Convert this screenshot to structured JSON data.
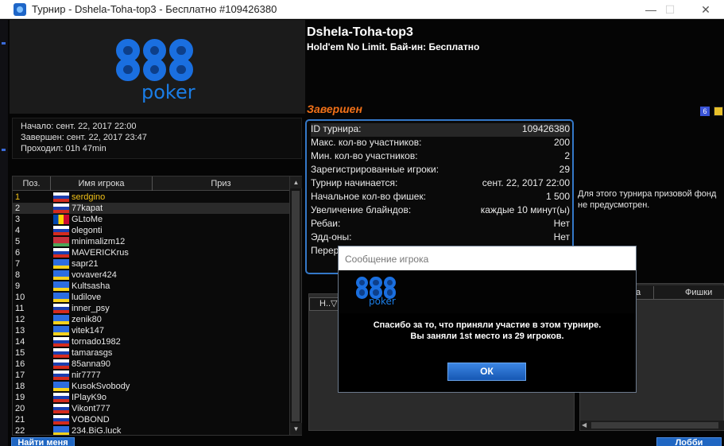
{
  "window": {
    "title": "Турнир - Dshela-Toha-top3 - Бесплатно #109426380",
    "app_icon": "poker-app-icon",
    "controls": {
      "minimize": "—",
      "maximize": "☐",
      "close": "✕"
    }
  },
  "logo": {
    "digits": "888",
    "word": "poker",
    "colors": {
      "ring": "#1a6fe0",
      "ring_inner": "#0d3f8a"
    }
  },
  "start_info": {
    "start": "Начало: сент. 22, 2017 22:00",
    "end": "Завершен: сент. 22, 2017 23:47",
    "elapsed": "Проходил: 01h 47min"
  },
  "players_table": {
    "headers": {
      "pos": "Поз.",
      "name": "Имя игрока",
      "prize": "Приз"
    },
    "rows": [
      {
        "pos": "1",
        "name": "serdgino",
        "flag": "ru"
      },
      {
        "pos": "2",
        "name": "77kapat",
        "flag": "ru"
      },
      {
        "pos": "3",
        "name": "GLtoMe",
        "flag": "md"
      },
      {
        "pos": "4",
        "name": "olegonti",
        "flag": "ru"
      },
      {
        "pos": "5",
        "name": "minimalizm12",
        "flag": "by"
      },
      {
        "pos": "6",
        "name": "MAVERICKrus",
        "flag": "ru"
      },
      {
        "pos": "7",
        "name": "sapr21",
        "flag": "ua"
      },
      {
        "pos": "8",
        "name": "vovaver424",
        "flag": "ua"
      },
      {
        "pos": "9",
        "name": "Kultsasha",
        "flag": "ua"
      },
      {
        "pos": "10",
        "name": "ludilove",
        "flag": "ua"
      },
      {
        "pos": "11",
        "name": "inner_psy",
        "flag": "ru"
      },
      {
        "pos": "12",
        "name": "zenik80",
        "flag": "ua"
      },
      {
        "pos": "13",
        "name": "vitek147",
        "flag": "ua"
      },
      {
        "pos": "14",
        "name": "tornado1982",
        "flag": "ru"
      },
      {
        "pos": "15",
        "name": "tamarasgs",
        "flag": "ru"
      },
      {
        "pos": "16",
        "name": "85anna90",
        "flag": "ru"
      },
      {
        "pos": "17",
        "name": "nir7777",
        "flag": "ru"
      },
      {
        "pos": "18",
        "name": "KusokSvobody",
        "flag": "ua"
      },
      {
        "pos": "19",
        "name": "IPlayK9o",
        "flag": "ru"
      },
      {
        "pos": "20",
        "name": "Vikont777",
        "flag": "ru"
      },
      {
        "pos": "21",
        "name": "VOBOND",
        "flag": "ru"
      },
      {
        "pos": "22",
        "name": "234.BiG.luck",
        "flag": "ua"
      }
    ],
    "selected_row": 1,
    "first_place_color": "#f0c018"
  },
  "buttons": {
    "find_me": "Найти меня",
    "lobby": "Лобби"
  },
  "tournament": {
    "name": "Dshela-Toha-top3",
    "type": "Hold'em No Limit. Бай-ин: Бесплатно",
    "status": "Завершен",
    "status_color": "#f07018"
  },
  "info": [
    {
      "k": "ID турнира:",
      "v": "109426380"
    },
    {
      "k": "Макс. кол-во участников:",
      "v": "200"
    },
    {
      "k": "Мин. кол-во участников:",
      "v": "2"
    },
    {
      "k": "Зарегистрированные игроки:",
      "v": "29"
    },
    {
      "k": "Турнир начинается:",
      "v": "сент. 22, 2017 22:00"
    },
    {
      "k": "Начальное кол-во фишек:",
      "v": "1 500"
    },
    {
      "k": "Увеличение блайндов:",
      "v": "каждые 10 минут(ы)"
    },
    {
      "k": "Ребаи:",
      "v": "Нет"
    },
    {
      "k": "Эдд-оны:",
      "v": "Нет"
    },
    {
      "k": "Перер",
      "v": ""
    }
  ],
  "prize_note": "Для этого турнира призовой фонд не предусмотрен.",
  "lower_left": {
    "header": "Н..▽"
  },
  "lower_right": {
    "col1": "а",
    "col2": "Фишки"
  },
  "modal": {
    "title": "Сообщение игрока",
    "message_line1": "Спасибо за то, что приняли участие в этом турнире.",
    "message_line2": "Вы заняли 1st место из 29 игроков.",
    "ok": "ОК"
  },
  "colors": {
    "accent_blue": "#1f66c2",
    "panel_border": "#3478c8",
    "background": "#050505"
  }
}
